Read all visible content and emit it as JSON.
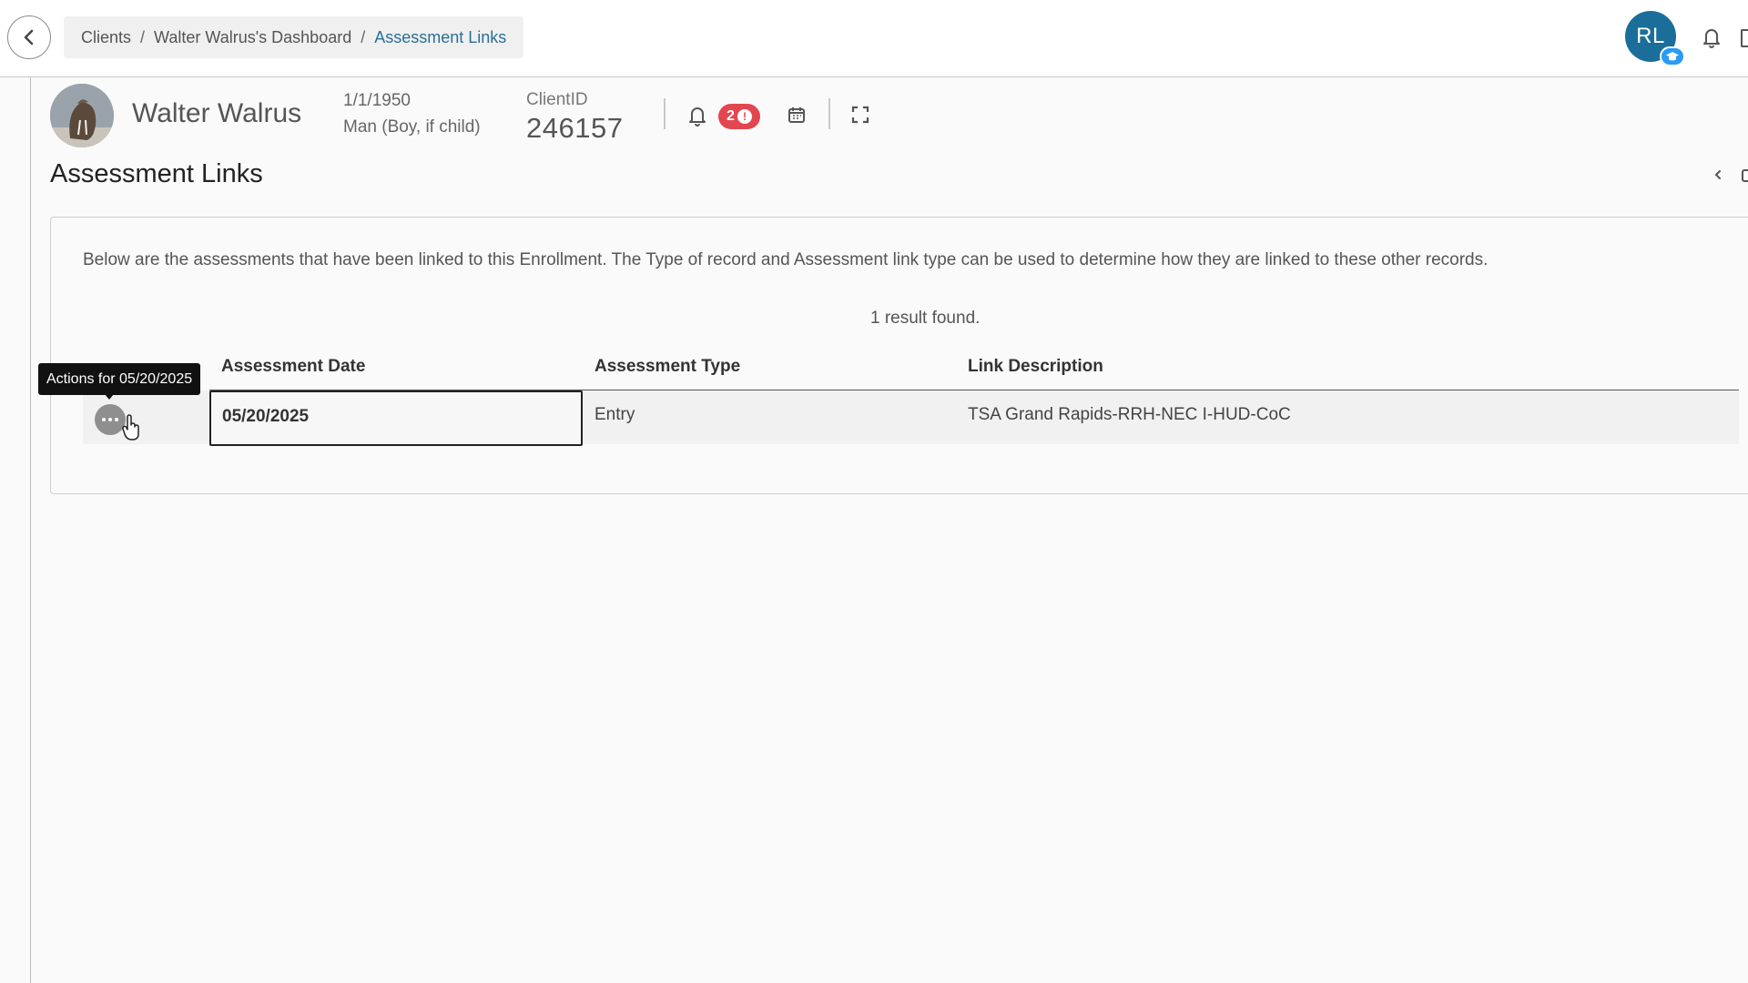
{
  "breadcrumb": {
    "items": [
      "Clients",
      "Walter Walrus's Dashboard"
    ],
    "separator": "/",
    "current": "Assessment Links"
  },
  "user": {
    "initials": "RL"
  },
  "client": {
    "name": "Walter Walrus",
    "dob": "1/1/1950",
    "gender": "Man (Boy, if child)",
    "id_label": "ClientID",
    "id_value": "246157",
    "alert_count": "2"
  },
  "page": {
    "title": "Assessment Links",
    "intro": "Below are the assessments that have been linked to this Enrollment.  The Type of record and Assessment link type can be used to determine how they are linked to these other records.",
    "results": "1 result found."
  },
  "table": {
    "headers": [
      "Assessment Date",
      "Assessment Type",
      "Link Description"
    ],
    "rows": [
      {
        "date": "05/20/2025",
        "type": "Entry",
        "link": "TSA Grand Rapids-RRH-NEC I-HUD-CoC"
      }
    ]
  },
  "tooltip": "Actions for 05/20/2025",
  "colors": {
    "accent": "#1b6e9a",
    "badge": "#e2474f",
    "breadcrumb_current": "#2a6f97"
  }
}
